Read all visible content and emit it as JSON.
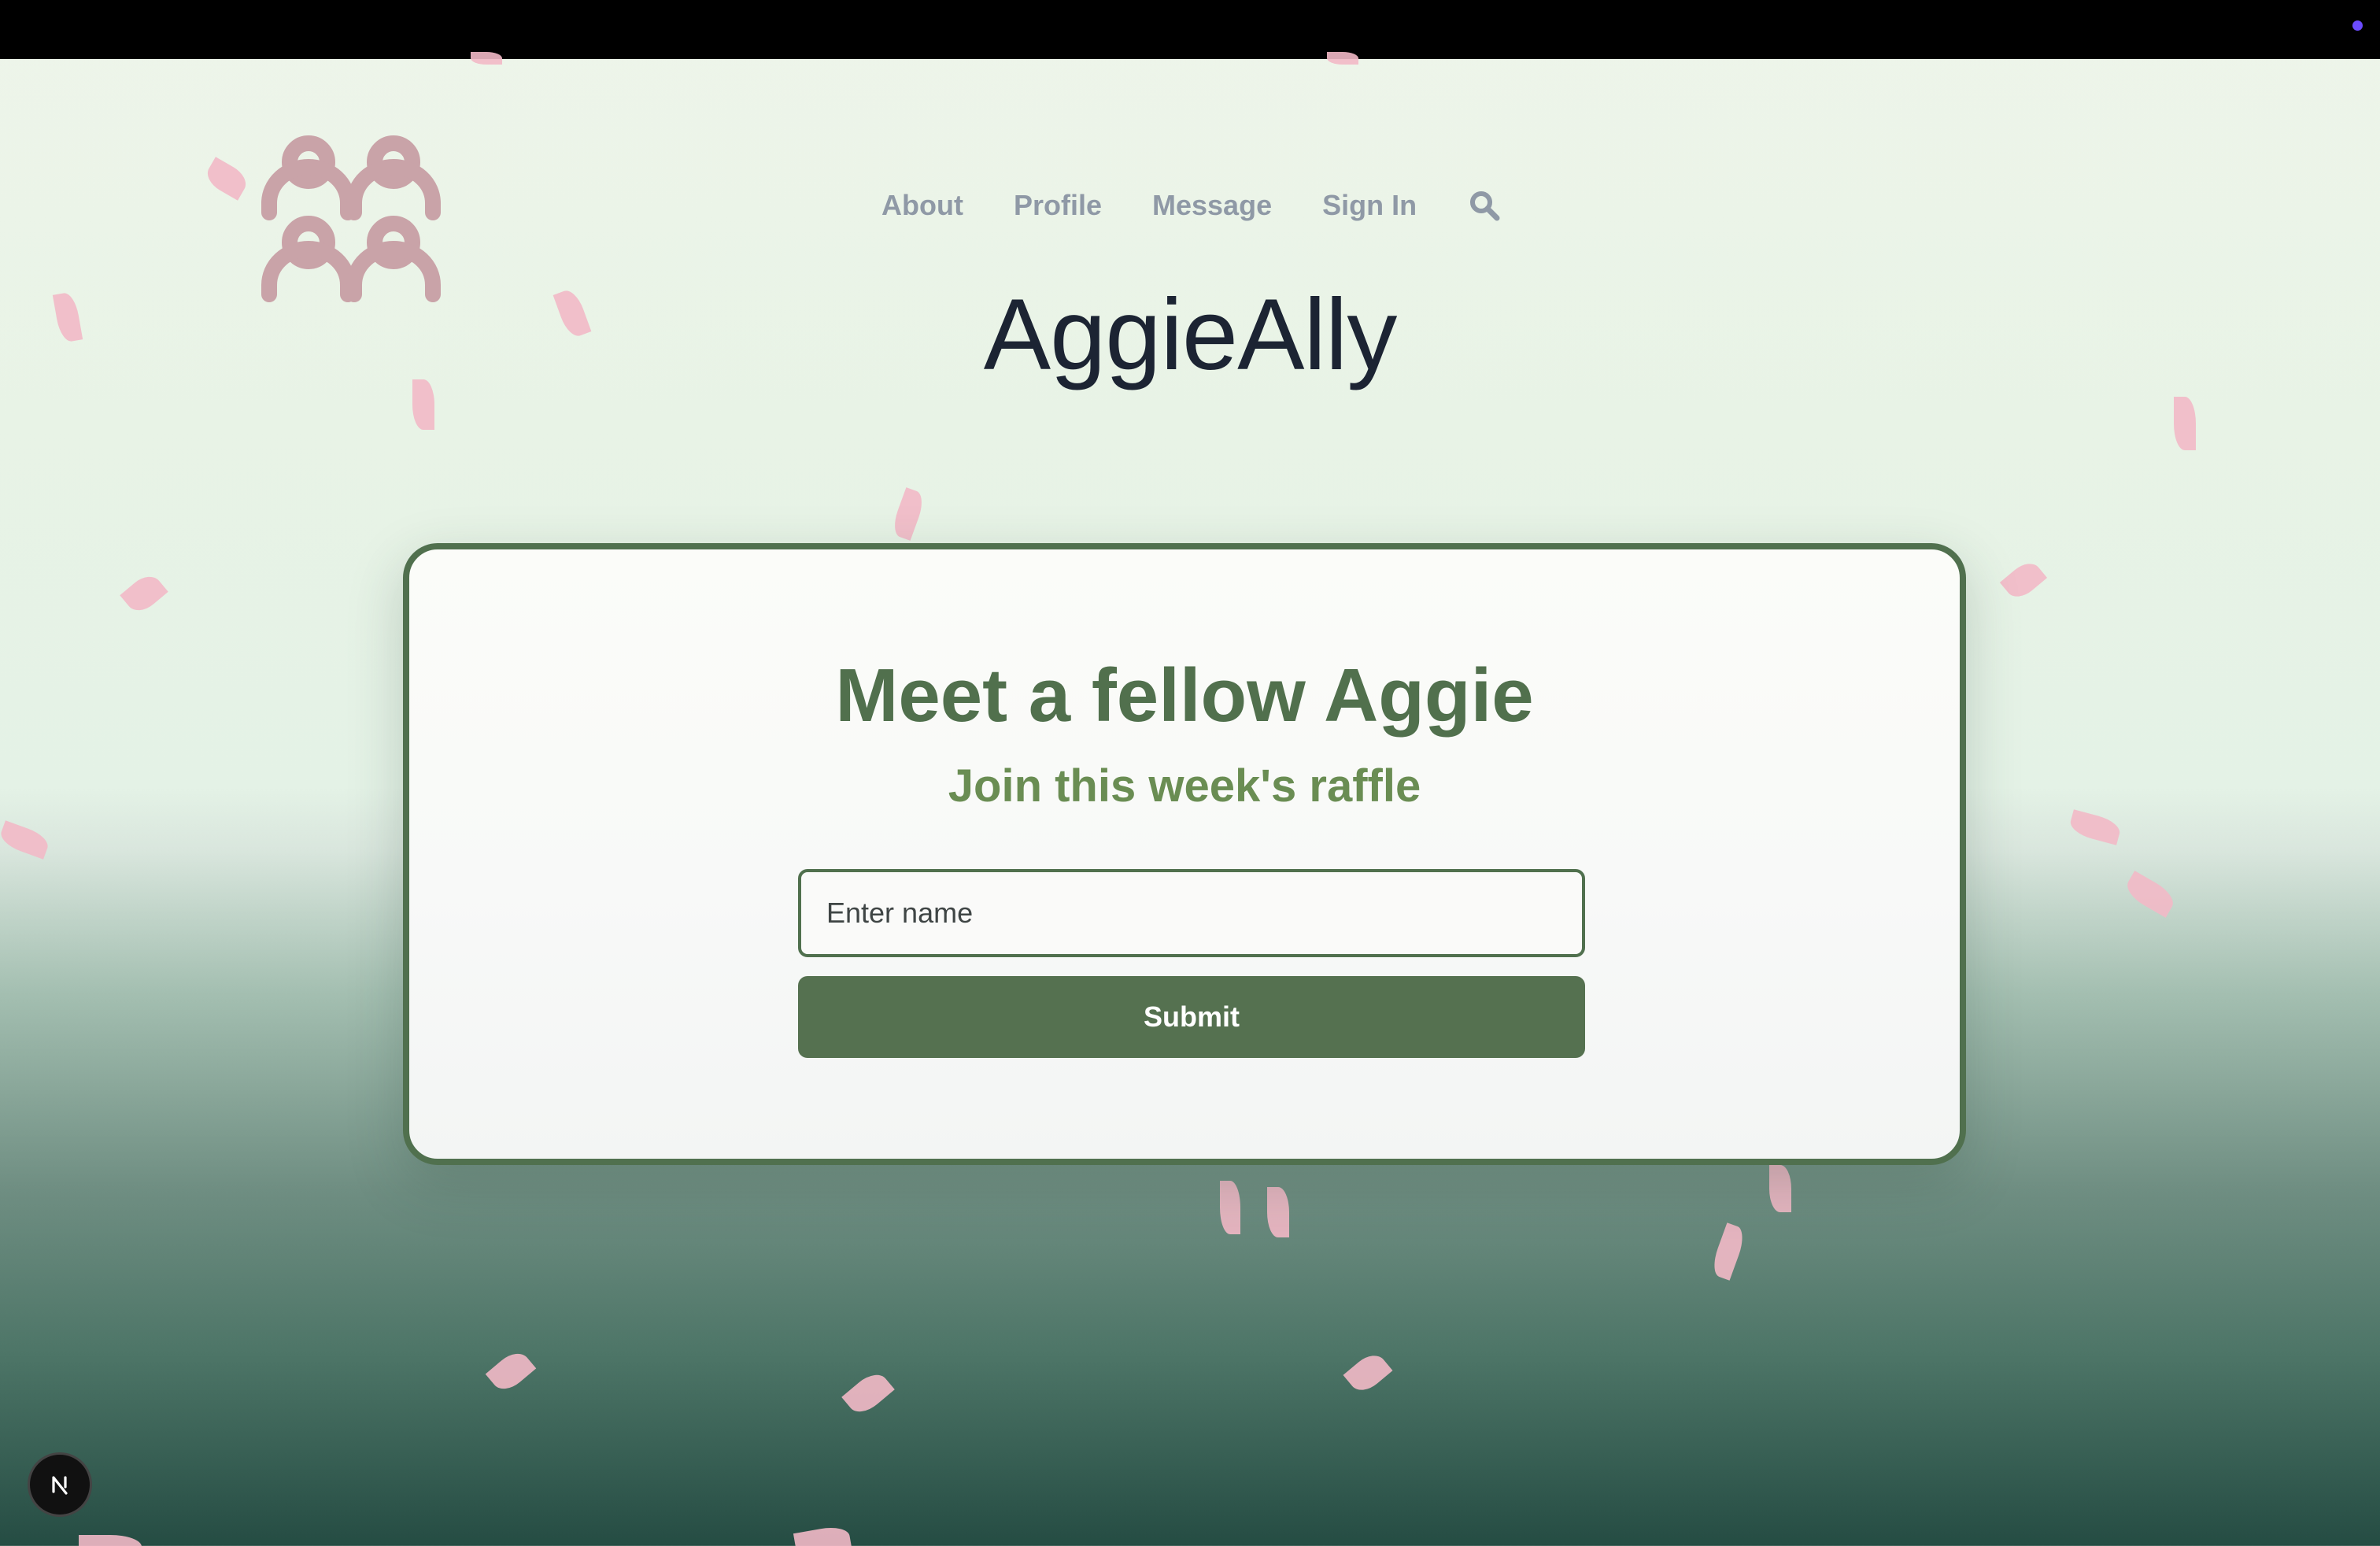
{
  "nav": {
    "items": [
      "About",
      "Profile",
      "Message",
      "Sign In"
    ],
    "search_icon": "search-icon"
  },
  "site": {
    "title": "AggieAlly",
    "logo_icon": "people-group-icon"
  },
  "card": {
    "heading": "Meet a fellow Aggie",
    "subheading": "Join this week's raffle",
    "input_placeholder": "Enter name",
    "input_value": "",
    "submit_label": "Submit"
  },
  "dev_badge": {
    "icon": "nextjs-logo-icon"
  },
  "colors": {
    "accent_green": "#557150",
    "subheading_green": "#6a8d53",
    "logo_pink": "#c9a3a8",
    "petal_pink": "#f2b9c6",
    "nav_gray": "#8f99a6",
    "title_navy": "#1c2433"
  }
}
